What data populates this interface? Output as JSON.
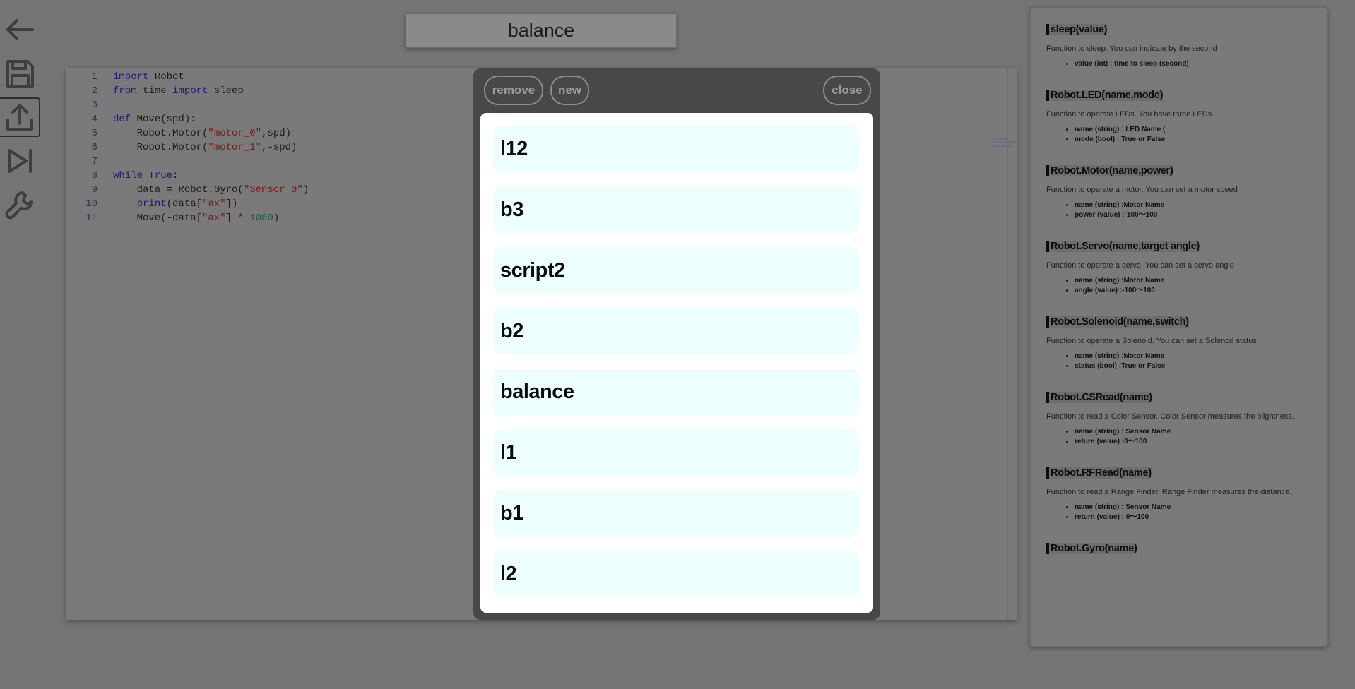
{
  "toolbar": {
    "items": [
      {
        "name": "back",
        "icon": "arrow-left-icon"
      },
      {
        "name": "save",
        "icon": "floppy-disk-icon"
      },
      {
        "name": "upload",
        "icon": "upload-icon",
        "active": true
      },
      {
        "name": "run",
        "icon": "skip-forward-icon"
      },
      {
        "name": "settings",
        "icon": "wrench-icon"
      }
    ]
  },
  "header": {
    "title": "balance"
  },
  "editor": {
    "lines": [
      {
        "n": "1",
        "html": "<span class=\"kw\">import</span> Robot"
      },
      {
        "n": "2",
        "html": "<span class=\"kw\">from</span> time <span class=\"kw\">import</span> sleep"
      },
      {
        "n": "3",
        "html": ""
      },
      {
        "n": "4",
        "html": "<span class=\"kw\">def</span> Move(spd):"
      },
      {
        "n": "5",
        "html": "    Robot.Motor(<span class=\"str\">\"motor_0\"</span>,spd)"
      },
      {
        "n": "6",
        "html": "    Robot.Motor(<span class=\"str\">\"motor_1\"</span>,-spd)"
      },
      {
        "n": "7",
        "html": ""
      },
      {
        "n": "8",
        "html": "<span class=\"kw\">while</span> <span class=\"kw\">True</span>:"
      },
      {
        "n": "9",
        "html": "    data = Robot.Gyro(<span class=\"str\">\"Sensor_0\"</span>)"
      },
      {
        "n": "10",
        "html": "    <span class=\"kw\">print</span>(data[<span class=\"str\">\"ax\"</span>])"
      },
      {
        "n": "11",
        "html": "    Move(-data[<span class=\"str\">\"ax\"</span>] * <span class=\"num\">1000</span>)"
      }
    ]
  },
  "modal": {
    "remove_label": "remove",
    "new_label": "new",
    "close_label": "close",
    "scripts": [
      "l12",
      "b3",
      "script2",
      "b2",
      "balance",
      "l1",
      "b1",
      "l2"
    ]
  },
  "reference": {
    "items": [
      {
        "title": "sleep(value)",
        "desc": "Function to sleep. You can indicate by the second",
        "params": [
          "value (int) : time to sleep (second)"
        ]
      },
      {
        "title": "Robot.LED(name,mode)",
        "desc": "Function to operate LEDs. You have three LEDs.",
        "params": [
          "name (string) : LED Name (",
          "mode (bool) : True or False"
        ]
      },
      {
        "title": "Robot.Motor(name,power)",
        "desc": "Function to operate a motor. You can set a motor speed",
        "params": [
          "name (string) :Motor Name",
          "power (value) :-100～100"
        ]
      },
      {
        "title": "Robot.Servo(name,target angle)",
        "desc": "Function to operate a servo. You can set a servo angle",
        "params": [
          "name (string) :Motor Name",
          "angle (value) :-100～100"
        ]
      },
      {
        "title": "Robot.Solenoid(name,switch)",
        "desc": "Function to operate a Solenoid. You can set a Solenod status",
        "params": [
          "name (string) :Motor Name",
          "status (bool) :True or False"
        ]
      },
      {
        "title": "Robot.CSRead(name)",
        "desc": "Function to read a Color Sensor. Color Sensor measures the blightness.",
        "params": [
          "name (string) : Sensor Name",
          "return (value) :0～100"
        ]
      },
      {
        "title": "Robot.RFRead(name)",
        "desc": "Function to read a Range Finder. Range Finder measures the distance.",
        "params": [
          "name (string) : Sensor Name",
          "return (value) : 0～100"
        ]
      },
      {
        "title": "Robot.Gyro(name)",
        "desc": "",
        "params": []
      }
    ]
  }
}
